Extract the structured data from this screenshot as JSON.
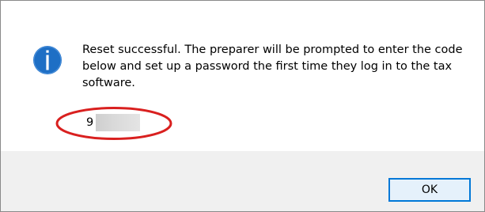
{
  "dialog": {
    "message": "Reset successful. The preparer will be prompted to enter the code below and set up a password the first time they log in to the tax software.",
    "code_visible": "9",
    "icon": "info-icon",
    "ok_label": "OK"
  },
  "colors": {
    "icon_blue": "#1e6fc5",
    "highlight_red": "#d9201f",
    "button_border": "#0078d7",
    "button_fill": "#e5f1fb",
    "footer_bg": "#f0f0f0"
  }
}
